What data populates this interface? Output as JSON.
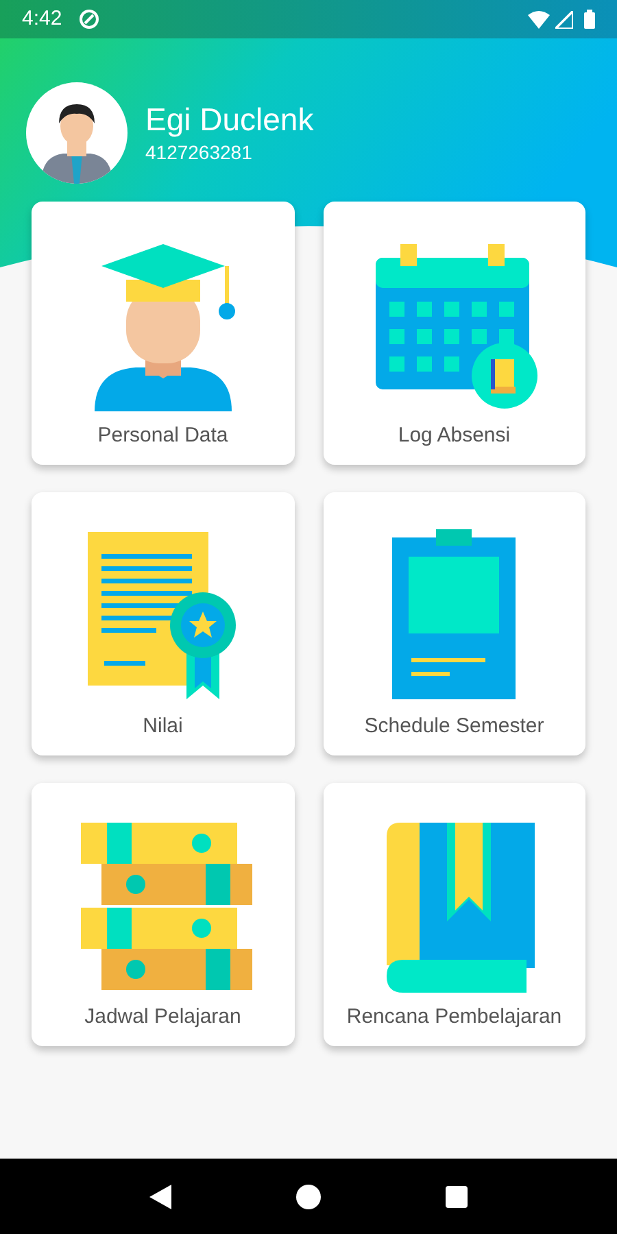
{
  "status_bar": {
    "time": "4:42"
  },
  "profile": {
    "name": "Egi Duclenk",
    "id": "4127263281"
  },
  "menu": [
    {
      "label": "Personal Data",
      "kind": "student"
    },
    {
      "label": "Log Absensi",
      "kind": "calendar"
    },
    {
      "label": "Nilai",
      "kind": "certificate"
    },
    {
      "label": "Schedule Semester",
      "kind": "clipboard"
    },
    {
      "label": "Jadwal Pelajaran",
      "kind": "books"
    },
    {
      "label": "Rencana Pembelajaran",
      "kind": "book"
    }
  ]
}
